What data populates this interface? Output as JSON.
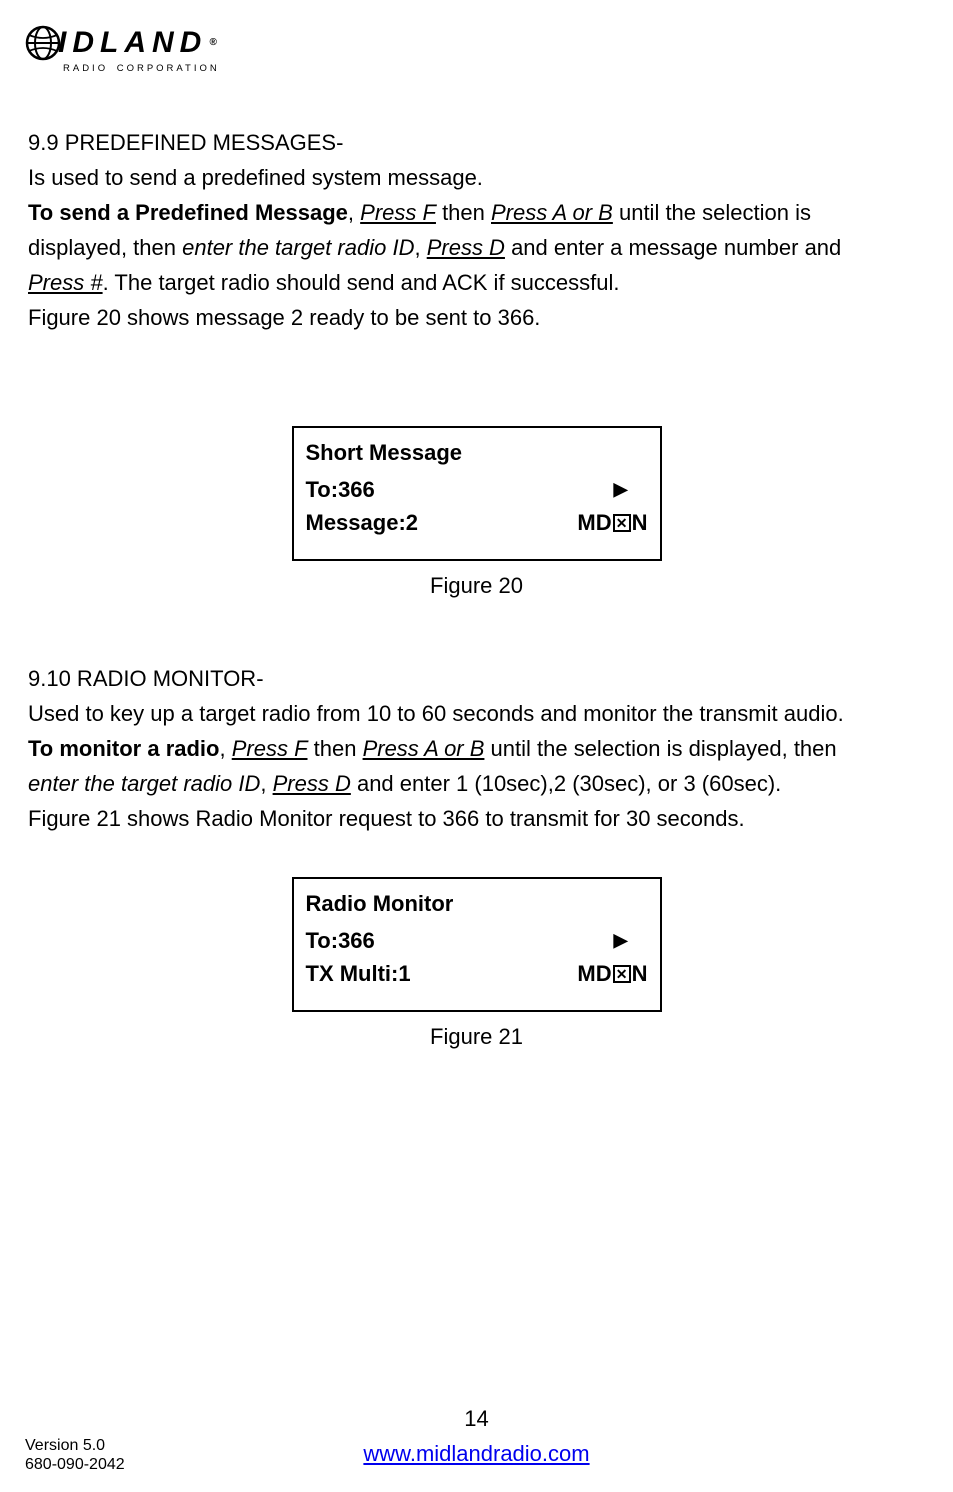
{
  "logo": {
    "brand": "IDLAND",
    "sub": "RADIO CORPORATION",
    "reg": "®"
  },
  "s99": {
    "heading": "9.9 PREDEFINED MESSAGES-",
    "l1": "Is used to send a predefined system message.",
    "l2a": "To send a Predefined Message",
    "l2b": ", ",
    "l2c": "Press F",
    "l2d": " then ",
    "l2e": "Press A or B",
    "l2f": " until the selection is ",
    "l3a": "displayed, then ",
    "l3b": "enter the target radio ID",
    "l3c": ", ",
    "l3d": "Press D",
    "l3e": " and enter a message number and ",
    "l4a": "Press #",
    "l4b": ". The target radio should send and ACK if successful.",
    "l5": "Figure 20 shows message 2 ready to be sent to 366."
  },
  "display1": {
    "title": "Short Message",
    "to": "To:366",
    "msg": "Message:2",
    "md": "MD",
    "x": "✕",
    "n": "N",
    "arrow": "▶",
    "caption": "Figure 20"
  },
  "s910": {
    "heading": "9.10 RADIO MONITOR-",
    "l1": "Used to key up a target radio from 10 to 60 seconds and monitor the transmit audio.",
    "l2a": "To monitor a radio",
    "l2b": ", ",
    "l2c": "Press F",
    "l2d": " then ",
    "l2e": "Press A or B",
    "l2f": " until the selection is displayed, then ",
    "l3a": "enter the target radio ID",
    "l3b": ", ",
    "l3c": "Press D",
    "l3d": " and enter 1 (10sec),2 (30sec), or 3 (60sec).",
    "l4": " Figure 21 shows Radio Monitor request to 366 to transmit for 30 seconds."
  },
  "display2": {
    "title": "Radio Monitor",
    "to": "To:366",
    "tx": "TX Multi:1",
    "md": "MD",
    "x": "✕",
    "n": "N",
    "arrow": "▶",
    "caption": "Figure 21"
  },
  "footer": {
    "page": "14",
    "url": "www.midlandradio.com",
    "v1": "Version 5.0",
    "v2": "680-090-2042"
  }
}
